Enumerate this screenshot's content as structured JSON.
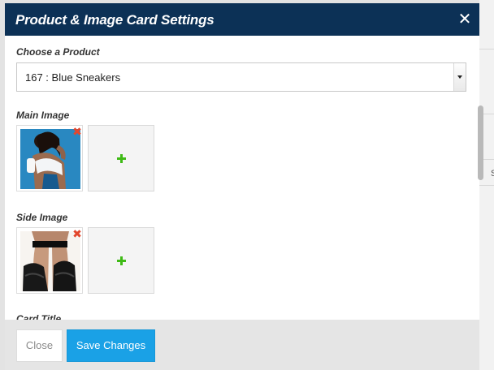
{
  "modal": {
    "title": "Product & Image Card Settings"
  },
  "product_field": {
    "label": "Choose a Product",
    "selected": "167 : Blue Sneakers"
  },
  "main_image": {
    "label": "Main Image"
  },
  "side_image": {
    "label": "Side Image"
  },
  "card_title": {
    "label": "Card Title"
  },
  "footer": {
    "close_label": "Close",
    "save_label": "Save Changes"
  },
  "backdrop": {
    "partial_text": "S"
  },
  "colors": {
    "header_bg": "#0c3156",
    "primary_button": "#1aa1e6",
    "remove_icon": "#e2462c",
    "add_icon": "#3fba16"
  }
}
